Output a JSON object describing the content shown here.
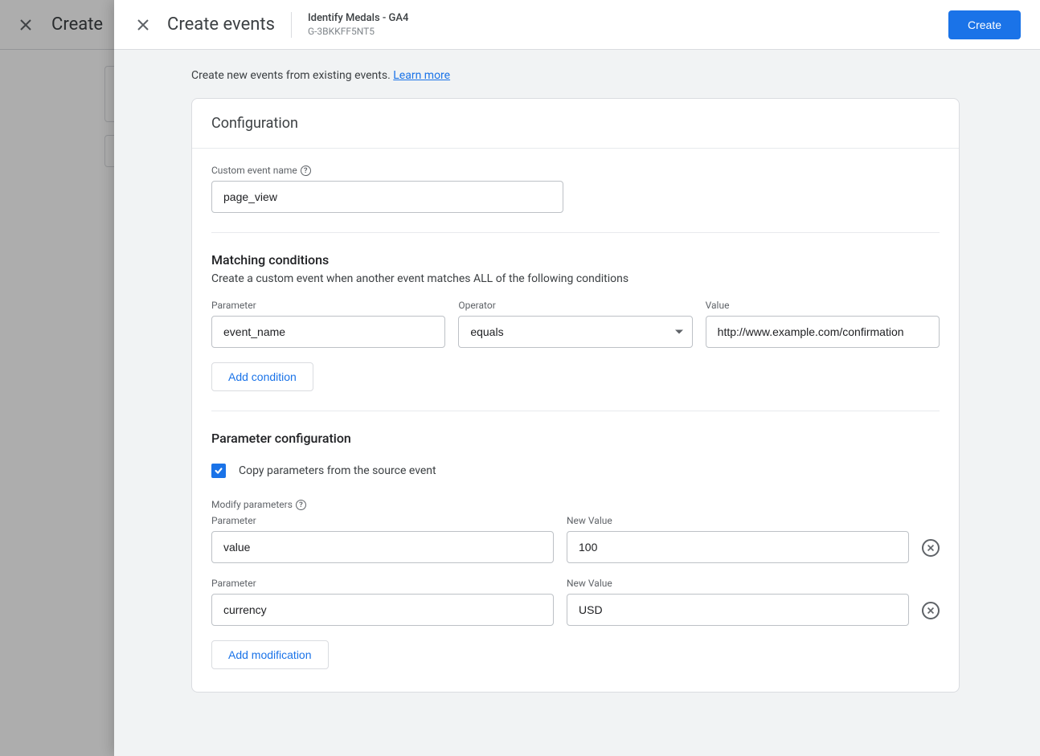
{
  "background": {
    "title": "Create"
  },
  "header": {
    "title": "Create events",
    "property_name": "Identify Medals - GA4",
    "property_id": "G-3BKKFF5NT5",
    "create_button": "Create"
  },
  "description": {
    "text": "Create new events from existing events. ",
    "link": "Learn more"
  },
  "config": {
    "card_title": "Configuration",
    "custom_event_name_label": "Custom event name",
    "custom_event_name_value": "page_view"
  },
  "matching": {
    "title": "Matching conditions",
    "subtitle": "Create a custom event when another event matches ALL of the following conditions",
    "labels": {
      "parameter": "Parameter",
      "operator": "Operator",
      "value": "Value"
    },
    "conditions": [
      {
        "parameter": "event_name",
        "operator": "equals",
        "value": "http://www.example.com/confirmation"
      }
    ],
    "add_button": "Add condition"
  },
  "param_config": {
    "title": "Parameter configuration",
    "copy_label": "Copy parameters from the source event",
    "copy_checked": true,
    "modify_label": "Modify parameters",
    "labels": {
      "parameter": "Parameter",
      "new_value": "New Value"
    },
    "modifications": [
      {
        "parameter": "value",
        "value": "100"
      },
      {
        "parameter": "currency",
        "value": "USD"
      }
    ],
    "add_button": "Add modification"
  }
}
